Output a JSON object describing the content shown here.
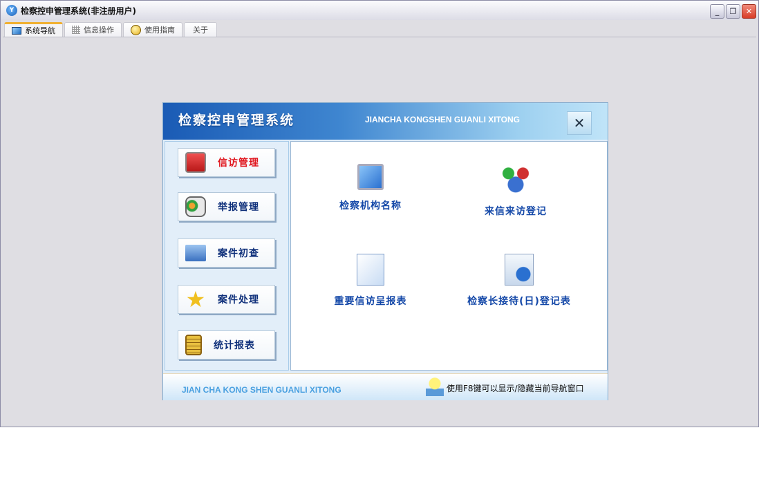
{
  "window": {
    "title": "检察控申管理系统(非注册用户)",
    "controls": [
      "minimize",
      "restore",
      "close"
    ]
  },
  "tabs": [
    {
      "label": "系统导航",
      "icon": "monitor-icon",
      "active": true
    },
    {
      "label": "信息操作",
      "icon": "grid-icon"
    },
    {
      "label": "使用指南",
      "icon": "help-icon"
    },
    {
      "label": "关于"
    }
  ],
  "panel": {
    "title_cn": "检察控申管理系统",
    "title_en": "JIANCHA KONGSHEN GUANLI XITONG",
    "close": "✕",
    "nav": [
      {
        "label": "信访管理",
        "icon": "alert-monitor-icon",
        "active": true
      },
      {
        "label": "举报管理",
        "icon": "contact-card-icon"
      },
      {
        "label": "案件初查",
        "icon": "folder-icon"
      },
      {
        "label": "案件处理",
        "icon": "star-icon"
      },
      {
        "label": "统计报表",
        "icon": "scroll-icon"
      }
    ],
    "items": [
      {
        "label": "检察机构名称",
        "icon": "computer-gear-icon"
      },
      {
        "label": "来信来访登记",
        "icon": "users-icon"
      },
      {
        "label": "重要信访呈报表",
        "icon": "document-icon"
      },
      {
        "label": "检察长接待(日)登记表",
        "icon": "globe-document-icon"
      }
    ],
    "footer_en": "JIAN CHA KONG SHEN GUANLI XITONG",
    "footer_tip": "使用F8键可以显示/隐藏当前导航窗口"
  },
  "colors": {
    "accent": "#1a5bb5",
    "active_nav": "#e0141c",
    "nav_text": "#0e2f7a"
  }
}
